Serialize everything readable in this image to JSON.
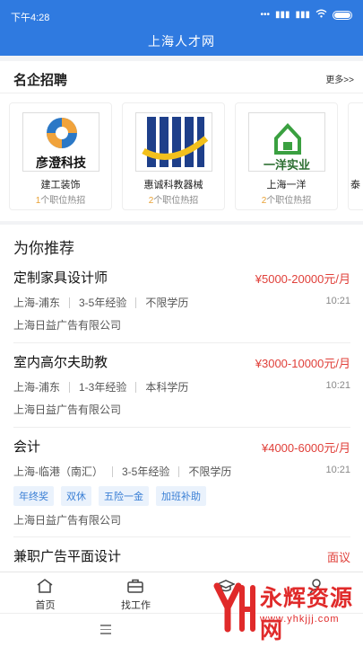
{
  "status": {
    "time": "下午4:28",
    "signal": "...  ᴴᴰ  ᴴᴰ"
  },
  "header": {
    "title": "上海人才网"
  },
  "famous": {
    "title": "名企招聘",
    "more": "更多>>",
    "companies": [
      {
        "logo_text": "彦澄科技",
        "name": "建工装饰",
        "count": "1",
        "hot": "个职位热招"
      },
      {
        "name": "惠诚科教器械",
        "count": "2",
        "hot": "个职位热招"
      },
      {
        "logo_text": "一洋实业",
        "name": "上海一洋",
        "count": "2",
        "hot": "个职位热招"
      },
      {
        "name": "泰"
      }
    ]
  },
  "recommend": {
    "title": "为你推荐",
    "jobs": [
      {
        "title": "定制家具设计师",
        "salary": "¥5000-20000元/月",
        "location": "上海-浦东",
        "experience": "3-5年经验",
        "education": "不限学历",
        "time": "10:21",
        "company": "上海日益广告有限公司"
      },
      {
        "title": "室内高尔夫助教",
        "salary": "¥3000-10000元/月",
        "location": "上海-浦东",
        "experience": "1-3年经验",
        "education": "本科学历",
        "time": "10:21",
        "company": "上海日益广告有限公司"
      },
      {
        "title": "会计",
        "salary": "¥4000-6000元/月",
        "location": "上海-临港（南汇）",
        "experience": "3-5年经验",
        "education": "不限学历",
        "time": "10:21",
        "tags": [
          "年终奖",
          "双休",
          "五险一金",
          "加班补助"
        ],
        "company": "上海日益广告有限公司"
      },
      {
        "title": "兼职广告平面设计",
        "salary": "面议"
      }
    ]
  },
  "tabbar": {
    "items": [
      {
        "label": "首页"
      },
      {
        "label": "找工作"
      },
      {
        "label": ""
      },
      {
        "label": ""
      }
    ]
  },
  "watermark": {
    "text": "永辉资源网",
    "url": "www.yhkjjj.com"
  },
  "colors": {
    "primary": "#2f7ae0",
    "salary": "#e0403a",
    "hot_count": "#e8a135",
    "watermark": "#e02a2a"
  }
}
